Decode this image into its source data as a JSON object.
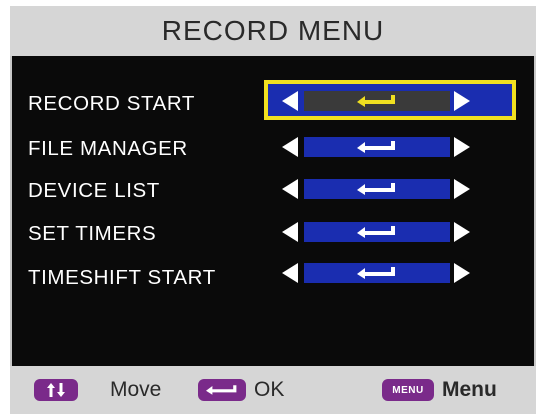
{
  "title": "RECORD MENU",
  "colors": {
    "selection_frame": "#f0e020",
    "slider_bar": "#1a2db0",
    "footer_pill": "#7a2a8a"
  },
  "items": [
    {
      "label": "RECORD START",
      "selected": true,
      "control_icon": "enter-icon"
    },
    {
      "label": "FILE MANAGER",
      "selected": false,
      "control_icon": "enter-icon"
    },
    {
      "label": "DEVICE LIST",
      "selected": false,
      "control_icon": "enter-icon"
    },
    {
      "label": "SET TIMERS",
      "selected": false,
      "control_icon": "enter-icon"
    },
    {
      "label": "TIMESHIFT START",
      "selected": false,
      "control_icon": "enter-icon"
    }
  ],
  "footer": {
    "move_icon": "up-down-arrows-icon",
    "move_label": "Move",
    "ok_icon": "enter-icon",
    "ok_label": "OK",
    "menu_button_text": "MENU",
    "menu_label": "Menu"
  }
}
